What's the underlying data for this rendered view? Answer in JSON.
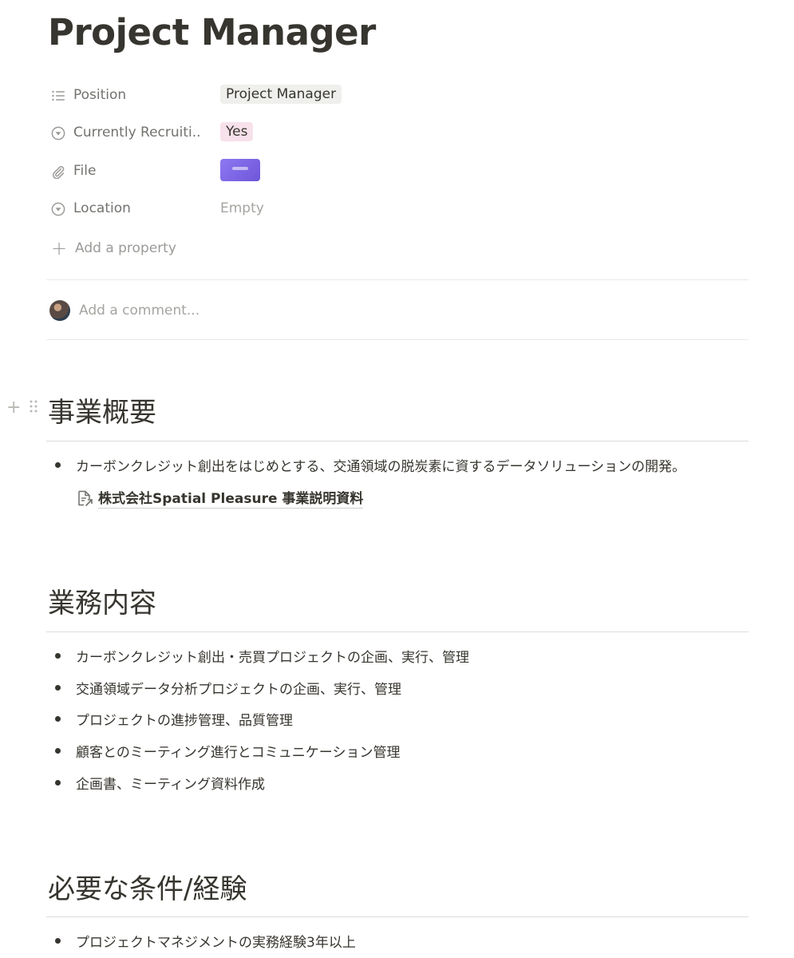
{
  "page": {
    "title": "Project Manager"
  },
  "properties": [
    {
      "icon": "list-icon",
      "name": "Position",
      "value": "Project Manager",
      "style": "chip-gray"
    },
    {
      "icon": "select-icon",
      "name": "Currently Recruiti...",
      "value": "Yes",
      "style": "chip-pink"
    },
    {
      "icon": "paperclip-icon",
      "name": "File",
      "value": "",
      "style": "file"
    },
    {
      "icon": "select-icon",
      "name": "Location",
      "value": "Empty",
      "style": "empty"
    }
  ],
  "add_property": {
    "label": "Add a property"
  },
  "comment": {
    "placeholder": "Add a comment..."
  },
  "sections": [
    {
      "heading": "事業概要",
      "bullets": [
        "カーボンクレジット創出をはじめとする、交通領域の脱炭素に資するデータソリューションの開発。"
      ],
      "link": "株式会社Spatial Pleasure 事業説明資料"
    },
    {
      "heading": "業務内容",
      "bullets": [
        "カーボンクレジット創出・売買プロジェクトの企画、実行、管理",
        "交通領域データ分析プロジェクトの企画、実行、管理",
        "プロジェクトの進捗管理、品質管理",
        "顧客とのミーティング進行とコミュニケーション管理",
        "企画書、ミーティング資料作成"
      ]
    },
    {
      "heading": "必要な条件/経験",
      "bullets": [
        "プロジェクトマネジメントの実務経験3年以上"
      ]
    }
  ],
  "colors": {
    "text": "#37352f",
    "muted": "#73726e",
    "placeholder": "#a5a4a0",
    "chip_gray": "#efefed",
    "chip_pink": "#f7e1ea",
    "file_thumb": "#7b63e6"
  }
}
